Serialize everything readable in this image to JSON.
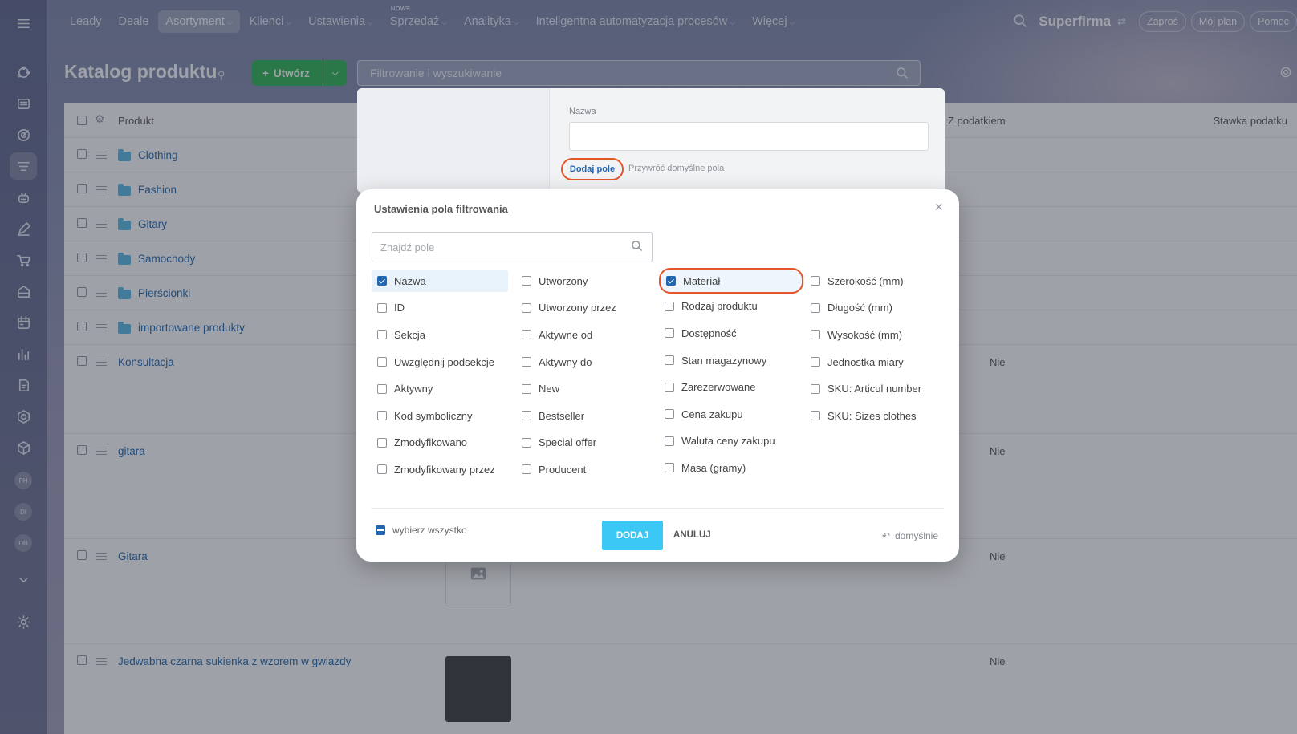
{
  "topnav": {
    "items": [
      {
        "label": "Leady",
        "chevron": ""
      },
      {
        "label": "Deale",
        "chevron": ""
      },
      {
        "label": "Asortyment",
        "chevron": "⌵"
      },
      {
        "label": "Klienci",
        "chevron": "⌵"
      },
      {
        "label": "Ustawienia",
        "chevron": "⌵"
      },
      {
        "label": "Sprzedaż",
        "chevron": "⌵",
        "badge": "NOWE"
      },
      {
        "label": "Analityka",
        "chevron": "⌵"
      },
      {
        "label": "Inteligentna automatyzacja procesów",
        "chevron": "⌵"
      },
      {
        "label": "Więcej",
        "chevron": "⌵"
      }
    ],
    "brand": "Superfirma",
    "brand_switch": "⇄",
    "invite_label": "Zaproś",
    "plan_label": "Mój plan",
    "help_label": "Pomoc"
  },
  "sidebar": {
    "avatars": [
      "PH",
      "DI",
      "DH"
    ]
  },
  "page": {
    "title": "Katalog produktu",
    "create_label": "Utwórz",
    "filter_placeholder": "Filtrowanie i wyszukiwanie"
  },
  "grid": {
    "columns": {
      "product": "Produkt",
      "with_tax": "Z podatkiem",
      "tax_rate": "Stawka podatku"
    },
    "rows": [
      {
        "name": "Clothing",
        "type": "folder",
        "tax": ""
      },
      {
        "name": "Fashion",
        "type": "folder",
        "tax": ""
      },
      {
        "name": "Gitary",
        "type": "folder",
        "tax": ""
      },
      {
        "name": "Samochody",
        "type": "folder",
        "tax": ""
      },
      {
        "name": "Pierścionki",
        "type": "folder",
        "tax": ""
      },
      {
        "name": "importowane produkty",
        "type": "folder",
        "tax": ""
      },
      {
        "name": "Konsultacja",
        "type": "product",
        "tax": "Nie"
      },
      {
        "name": "gitara",
        "type": "product",
        "tax": "Nie"
      },
      {
        "name": "Gitara",
        "type": "product",
        "tax": "Nie"
      },
      {
        "name": "Jedwabna czarna sukienka z wzorem w gwiazdy",
        "type": "product",
        "tax": "Nie"
      }
    ]
  },
  "filter_panel": {
    "field_label": "Nazwa",
    "add_field_label": "Dodaj pole",
    "reset_label": "Przywróć domyślne pola"
  },
  "modal": {
    "title": "Ustawienia pola filtrowania",
    "close": "×",
    "search_placeholder": "Znajdź pole",
    "columns": [
      [
        {
          "label": "Nazwa",
          "checked": true
        },
        {
          "label": "ID",
          "checked": false
        },
        {
          "label": "Sekcja",
          "checked": false
        },
        {
          "label": "Uwzględnij podsekcje",
          "checked": false
        },
        {
          "label": "Aktywny",
          "checked": false
        },
        {
          "label": "Kod symboliczny",
          "checked": false
        },
        {
          "label": "Zmodyfikowano",
          "checked": false
        },
        {
          "label": "Zmodyfikowany przez",
          "checked": false
        }
      ],
      [
        {
          "label": "Utworzony",
          "checked": false
        },
        {
          "label": "Utworzony przez",
          "checked": false
        },
        {
          "label": "Aktywne od",
          "checked": false
        },
        {
          "label": "Aktywny do",
          "checked": false
        },
        {
          "label": "New",
          "checked": false
        },
        {
          "label": "Bestseller",
          "checked": false
        },
        {
          "label": "Special offer",
          "checked": false
        },
        {
          "label": "Producent",
          "checked": false
        }
      ],
      [
        {
          "label": "Materiał",
          "checked": true
        },
        {
          "label": "Rodzaj produktu",
          "checked": false
        },
        {
          "label": "Dostępność",
          "checked": false
        },
        {
          "label": "Stan magazynowy",
          "checked": false
        },
        {
          "label": "Zarezerwowane",
          "checked": false
        },
        {
          "label": "Cena zakupu",
          "checked": false
        },
        {
          "label": "Waluta ceny zakupu",
          "checked": false
        },
        {
          "label": "Masa (gramy)",
          "checked": false
        }
      ],
      [
        {
          "label": "Szerokość (mm)",
          "checked": false
        },
        {
          "label": "Długość (mm)",
          "checked": false
        },
        {
          "label": "Wysokość (mm)",
          "checked": false
        },
        {
          "label": "Jednostka miary",
          "checked": false
        },
        {
          "label": "SKU: Articul number",
          "checked": false
        },
        {
          "label": "SKU: Sizes clothes",
          "checked": false
        }
      ]
    ],
    "select_all_label": "wybierz wszystko",
    "add_label": "DODAJ",
    "cancel_label": "ANULUJ",
    "default_label": "domyślnie"
  },
  "colors": {
    "accent": "#2066b0",
    "create_green": "#2db550",
    "add_blue": "#3bc8f5",
    "highlight": "#e5552a"
  }
}
